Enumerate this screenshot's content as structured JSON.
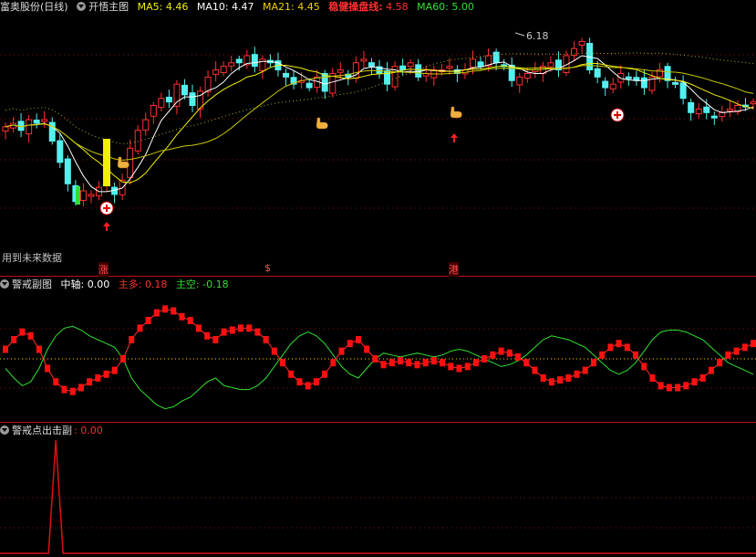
{
  "main_header": {
    "stock": "富奥股份(日线)",
    "indicator": "开悟主图",
    "ma5": {
      "label": "MA5:",
      "value": "4.46",
      "color": "#f0f000"
    },
    "ma10": {
      "label": "MA10:",
      "value": "4.47",
      "color": "#ffffff"
    },
    "ma21": {
      "label": "MA21:",
      "value": "4.45",
      "color": "#f0d000"
    },
    "steady": {
      "label": "稳健操盘线:",
      "value": "4.58",
      "color": "#ff3030"
    },
    "ma60": {
      "label": "MA60:",
      "value": "5.00",
      "color": "#30e030"
    }
  },
  "future_note": "用到未来数据",
  "peak_label": "6.18",
  "bottom_marks": [
    "涨",
    "$",
    "港"
  ],
  "sub1_header": {
    "name": "警戒副图",
    "axis": {
      "label": "中轴:",
      "value": "0.00"
    },
    "bull": {
      "label": "主多:",
      "value": "0.18",
      "color": "#ff3030"
    },
    "bear": {
      "label": "主空:",
      "value": "-0.18",
      "color": "#30e030"
    }
  },
  "sub2_header": {
    "name": "警戒点出击副",
    "value": ": 0.00"
  },
  "chart_data": [
    {
      "type": "candlestick",
      "title": "开悟主图",
      "series": [
        {
          "name": "MA5",
          "value": 4.46
        },
        {
          "name": "MA10",
          "value": 4.47
        },
        {
          "name": "MA21",
          "value": 4.45
        },
        {
          "name": "稳健操盘线",
          "value": 4.58
        },
        {
          "name": "MA60",
          "value": 5.0
        }
      ],
      "close": [
        4.9,
        4.95,
        4.85,
        5.0,
        4.95,
        5.0,
        4.7,
        4.4,
        4.1,
        3.85,
        4.0,
        3.95,
        4.05,
        4.1,
        3.95,
        4.15,
        4.6,
        4.85,
        5.0,
        5.2,
        5.3,
        5.25,
        5.5,
        5.35,
        5.2,
        5.4,
        5.6,
        5.7,
        5.75,
        5.8,
        5.8,
        5.9,
        5.75,
        5.85,
        5.8,
        5.7,
        5.6,
        5.5,
        5.55,
        5.45,
        5.6,
        5.4,
        5.65,
        5.7,
        5.6,
        5.8,
        5.85,
        5.75,
        5.65,
        5.5,
        5.75,
        5.7,
        5.8,
        5.6,
        5.65,
        5.7,
        5.7,
        5.75,
        5.65,
        5.7,
        5.85,
        5.75,
        5.9,
        5.8,
        5.75,
        5.55,
        5.6,
        5.65,
        5.7,
        5.75,
        5.8,
        5.7,
        5.9,
        6.0,
        6.1,
        5.7,
        5.6,
        5.45,
        5.5,
        5.65,
        5.6,
        5.55,
        5.45,
        5.6,
        5.7,
        5.55,
        5.5,
        5.3,
        5.1,
        5.15,
        5.1,
        5.05,
        5.1,
        5.15,
        5.2,
        5.2,
        5.25
      ],
      "period_high": 6.18,
      "ylim": [
        3.5,
        6.4
      ]
    },
    {
      "type": "line",
      "title": "警戒副图",
      "series": [
        {
          "name": "主多",
          "value": 0.18
        },
        {
          "name": "主空",
          "value": -0.18
        }
      ],
      "red": [
        0.05,
        0.1,
        0.14,
        0.12,
        0.05,
        -0.05,
        -0.12,
        -0.16,
        -0.17,
        -0.15,
        -0.12,
        -0.1,
        -0.08,
        -0.06,
        0,
        0.1,
        0.16,
        0.2,
        0.24,
        0.26,
        0.25,
        0.22,
        0.2,
        0.16,
        0.12,
        0.1,
        0.14,
        0.15,
        0.16,
        0.16,
        0.14,
        0.1,
        0.04,
        -0.02,
        -0.08,
        -0.12,
        -0.14,
        -0.12,
        -0.08,
        -0.02,
        0.04,
        0.08,
        0.1,
        0.05,
        0,
        -0.03,
        -0.02,
        -0.01,
        -0.02,
        -0.03,
        -0.02,
        -0.01,
        -0.02,
        -0.04,
        -0.05,
        -0.04,
        -0.02,
        0,
        0.02,
        0.04,
        0.03,
        0.01,
        -0.02,
        -0.06,
        -0.1,
        -0.12,
        -0.11,
        -0.1,
        -0.08,
        -0.06,
        -0.02,
        0.02,
        0.06,
        0.08,
        0.06,
        0.02,
        -0.04,
        -0.1,
        -0.14,
        -0.15,
        -0.15,
        -0.14,
        -0.12,
        -0.1,
        -0.06,
        -0.02,
        0.02,
        0.04,
        0.06,
        0.08
      ],
      "ylim": [
        -0.3,
        0.3
      ]
    },
    {
      "type": "line",
      "title": "警戒点出击副",
      "value": 0.0,
      "spike_index": 6,
      "ylim": [
        0,
        1
      ]
    }
  ],
  "colors": {
    "up": "#ff3030",
    "down": "#54f0f0",
    "grid": "#8a1010",
    "white": "#ffffff",
    "yellow": "#f0f000",
    "cyan": "#54f0f0"
  }
}
